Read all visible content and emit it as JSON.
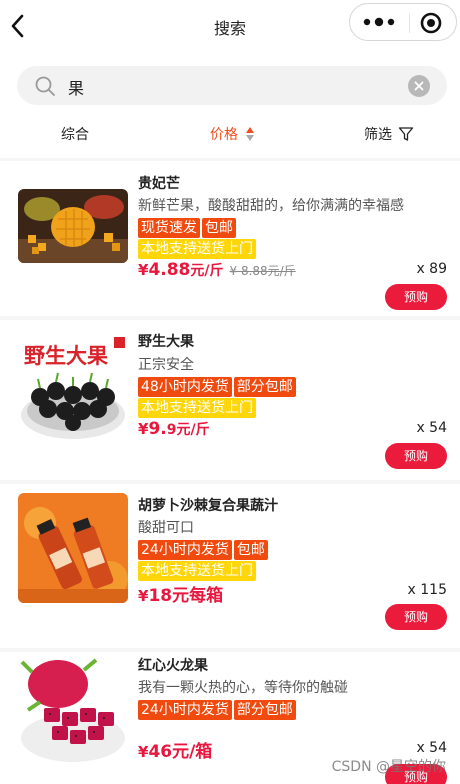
{
  "header": {
    "title": "搜索"
  },
  "search": {
    "query": "果"
  },
  "sort_tabs": [
    {
      "label": "综合"
    },
    {
      "label": "价格"
    },
    {
      "label": "筛选"
    }
  ],
  "colors": {
    "accent": "#ef4e1e",
    "price": "#e8173e",
    "buy": "#eb1b3b",
    "tag_red": "#f04a0f",
    "tag_yellow": "#ffd60a"
  },
  "products": [
    {
      "title": "贵妃芒",
      "desc": "新鲜芒果，酸酸甜甜的，给你满满的幸福感",
      "tags_row1": [
        "现货速发",
        "包邮"
      ],
      "tags_row2": [
        "本地支持送货上门"
      ],
      "price_symbol": "¥",
      "price_main": "4.88",
      "price_unit": "元/斤",
      "original_price": "¥ 8.88元/斤",
      "quantity": "x 89",
      "buy_label": "预购"
    },
    {
      "title": "野生大果",
      "desc": "正宗安全",
      "tags_row1": [
        "48小时内发货",
        "部分包邮"
      ],
      "tags_row2": [
        "本地支持送货上门"
      ],
      "price_symbol": "¥",
      "price_main": "9.",
      "price_unit": "9元/斤",
      "quantity": "x 54",
      "buy_label": "预购",
      "image_text": "野生大果"
    },
    {
      "title": "胡萝卜沙棘复合果蔬汁",
      "desc": "酸甜可口",
      "tags_row1": [
        "24小时内发货",
        "包邮"
      ],
      "tags_row2": [
        "本地支持送货上门"
      ],
      "price_symbol": "¥",
      "price_main": "18元每箱",
      "quantity": "x 115",
      "buy_label": "预购"
    },
    {
      "title": "红心火龙果",
      "desc": "我有一颗火热的心，等待你的触碰",
      "tags_row1": [
        "24小时内发货",
        "部分包邮"
      ],
      "price_symbol": "¥",
      "price_main": "46元/箱",
      "quantity": "x 54",
      "buy_label": "预购"
    }
  ],
  "watermark": "CSDN @星空的你"
}
